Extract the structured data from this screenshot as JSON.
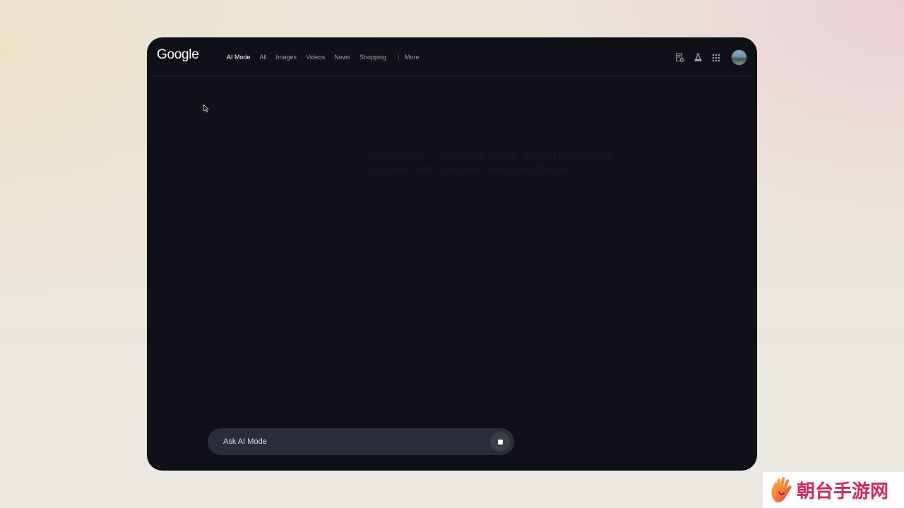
{
  "header": {
    "logo": "Google",
    "tabs": [
      {
        "label": "AI Mode",
        "active": true
      },
      {
        "label": "All",
        "active": false
      },
      {
        "label": "Images",
        "active": false
      },
      {
        "label": "Videos",
        "active": false
      },
      {
        "label": "News",
        "active": false
      },
      {
        "label": "Shopping",
        "active": false
      }
    ],
    "more_label": "More",
    "icons": [
      "history-icon",
      "labs-flask-icon",
      "apps-grid-icon",
      "account-avatar"
    ]
  },
  "main": {
    "ghost_text": "Ask anything — see the full picture, detailed comparisons, and more, with information from across the web"
  },
  "composer": {
    "placeholder": "Ask AI Mode",
    "stop_icon": "stop-icon"
  },
  "watermark": {
    "text": "朝台手游网"
  },
  "colors": {
    "window_bg": "#101118",
    "composer_bg": "#2b2d3a",
    "active_tab": "#ffffff",
    "inactive_tab": "#9a9ca4",
    "watermark": "#d8245e"
  }
}
